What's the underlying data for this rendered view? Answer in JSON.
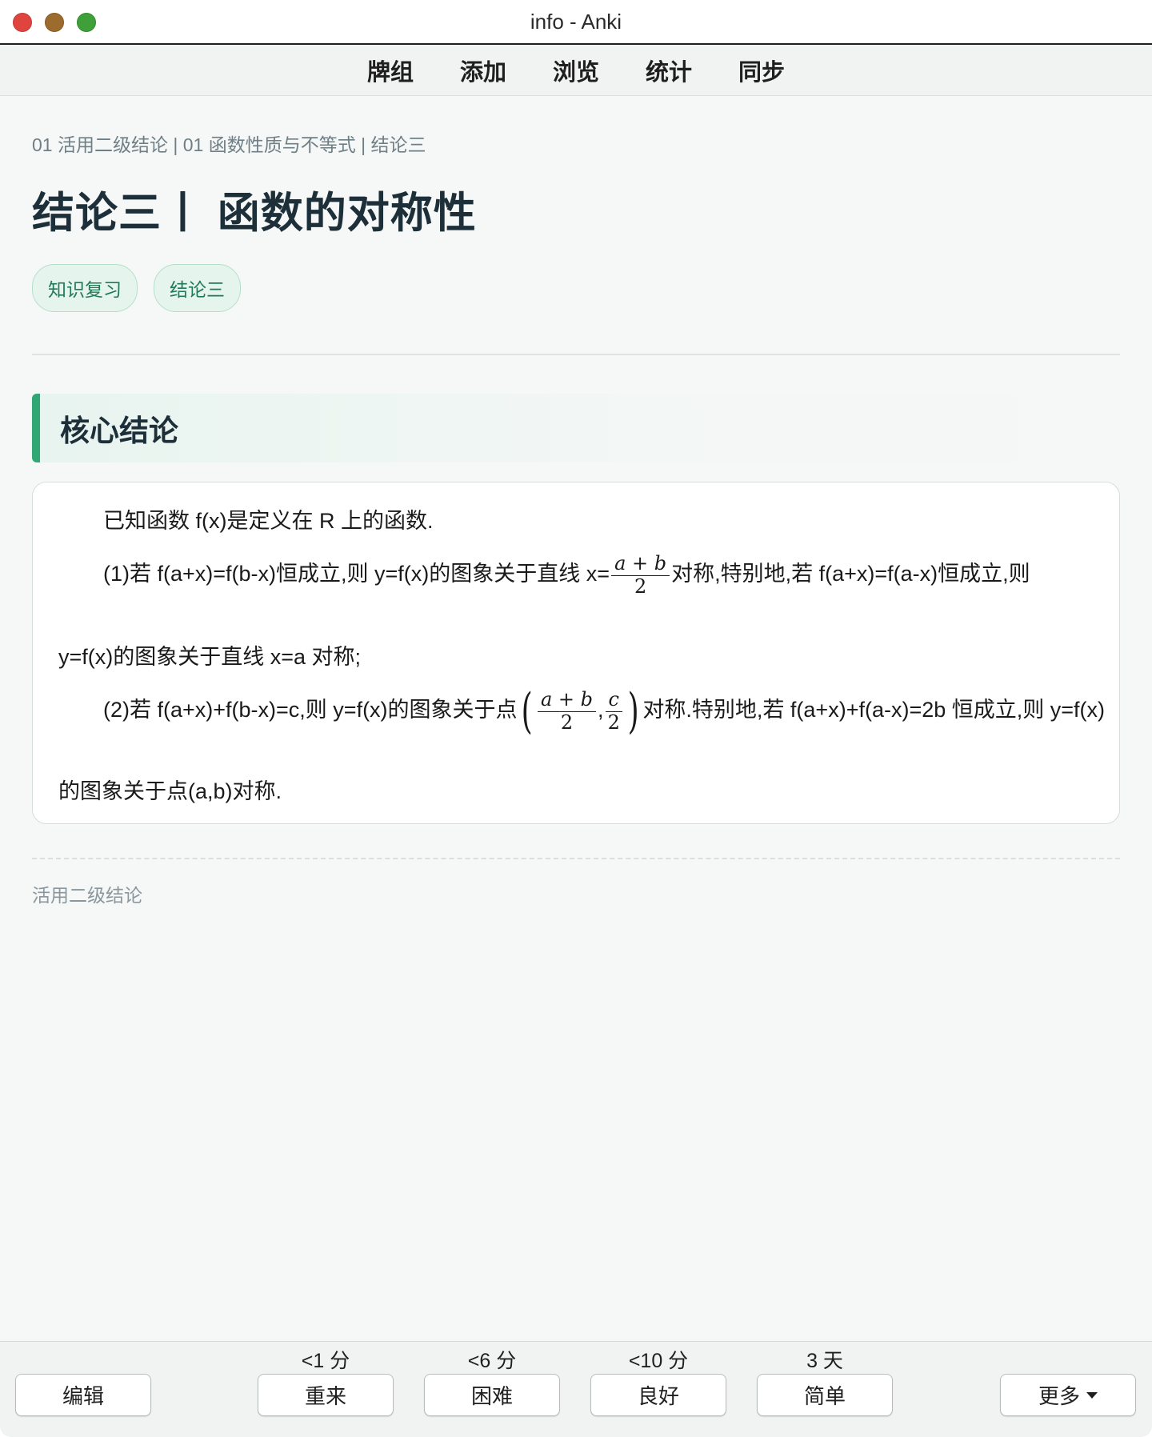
{
  "window": {
    "title": "info - Anki"
  },
  "nav": {
    "items": [
      "牌组",
      "添加",
      "浏览",
      "统计",
      "同步"
    ]
  },
  "card": {
    "breadcrumb": "01 活用二级结论 | 01 函数性质与不等式 | 结论三",
    "title": "结论三丨 函数的对称性",
    "tags": [
      "知识复习",
      "结论三"
    ],
    "section_title": "核心结论",
    "body": {
      "intro": "已知函数 f(x)是定义在 R 上的函数.",
      "p1_a": "(1)若 f(a+x)=f(b-x)恒成立,则 y=f(x)的图象关于直线 x=",
      "p1_frac_num": "a + b",
      "p1_frac_den": "2",
      "p1_b": "对称,特别地,若 f(a+x)=f(a-x)恒成立,则",
      "p1_c": "y=f(x)的图象关于直线 x=a 对称;",
      "p2_a": "(2)若 f(a+x)+f(b-x)=c,则 y=f(x)的图象关于点",
      "p2_frac1_num": "a + b",
      "p2_frac1_den": "2",
      "p2_frac2_num": "c",
      "p2_frac2_den": "2",
      "p2_b": "对称.特别地,若 f(a+x)+f(a-x)=2b 恒成立,则 y=f(x)",
      "p2_c": "的图象关于点(a,b)对称."
    },
    "footer": "活用二级结论"
  },
  "answer_bar": {
    "edit": "编辑",
    "more": "更多",
    "buttons": [
      {
        "label": "重来",
        "interval": "<1 分"
      },
      {
        "label": "困难",
        "interval": "<6 分"
      },
      {
        "label": "良好",
        "interval": "<10 分"
      },
      {
        "label": "简单",
        "interval": "3 天"
      }
    ]
  },
  "colors": {
    "accent": "#2fa873",
    "tag_text": "#1f7a55",
    "tag_bg": "#e6f4ee"
  }
}
